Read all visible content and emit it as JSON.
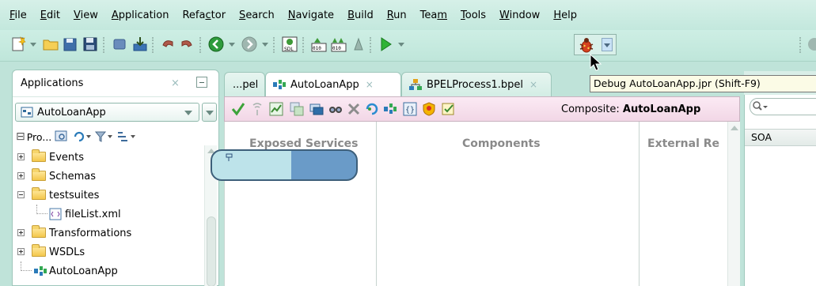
{
  "menubar": {
    "items": [
      {
        "pre": "",
        "u": "F",
        "post": "ile"
      },
      {
        "pre": "",
        "u": "E",
        "post": "dit"
      },
      {
        "pre": "",
        "u": "V",
        "post": "iew"
      },
      {
        "pre": "",
        "u": "A",
        "post": "pplication"
      },
      {
        "pre": "Refa",
        "u": "c",
        "post": "tor"
      },
      {
        "pre": "",
        "u": "S",
        "post": "earch"
      },
      {
        "pre": "",
        "u": "N",
        "post": "avigate"
      },
      {
        "pre": "",
        "u": "B",
        "post": "uild"
      },
      {
        "pre": "",
        "u": "R",
        "post": "un"
      },
      {
        "pre": "Tea",
        "u": "m",
        "post": ""
      },
      {
        "pre": "",
        "u": "T",
        "post": "ools"
      },
      {
        "pre": "",
        "u": "W",
        "post": "indow"
      },
      {
        "pre": "",
        "u": "H",
        "post": "elp"
      }
    ]
  },
  "tooltip": {
    "text": "Debug AutoLoanApp.jpr (Shift-F9)"
  },
  "applications": {
    "title": "Applications",
    "close_glyph": "×",
    "selected_app": "AutoLoanApp",
    "projects_label": "Pro...",
    "tree": [
      {
        "label": "Events",
        "type": "folder",
        "state": "collapsed"
      },
      {
        "label": "Schemas",
        "type": "folder",
        "state": "collapsed"
      },
      {
        "label": "testsuites",
        "type": "folder",
        "state": "expanded"
      },
      {
        "label": "fileList.xml",
        "type": "xml-file",
        "state": "leaf"
      },
      {
        "label": "Transformations",
        "type": "folder",
        "state": "collapsed"
      },
      {
        "label": "WSDLs",
        "type": "folder",
        "state": "collapsed"
      },
      {
        "label": "AutoLoanApp",
        "type": "composite",
        "state": "leaf"
      }
    ]
  },
  "editor": {
    "tabs": [
      {
        "label": "...pel",
        "active": false
      },
      {
        "label": "AutoLoanApp",
        "active": true,
        "close": "×"
      },
      {
        "label": "BPELProcess1.bpel",
        "active": false,
        "close": "×"
      }
    ],
    "composite_prefix": "Composite:",
    "composite_name": "AutoLoanApp",
    "columns": {
      "exposed": "Exposed Services",
      "components": "Components",
      "external": "External Re"
    }
  },
  "right_panel": {
    "category": "SOA"
  },
  "colors": {
    "chrome": "#bfe3d9",
    "diagram_toolbar": "#f2d7e6",
    "tooltip_bg": "#fbfbe6"
  }
}
